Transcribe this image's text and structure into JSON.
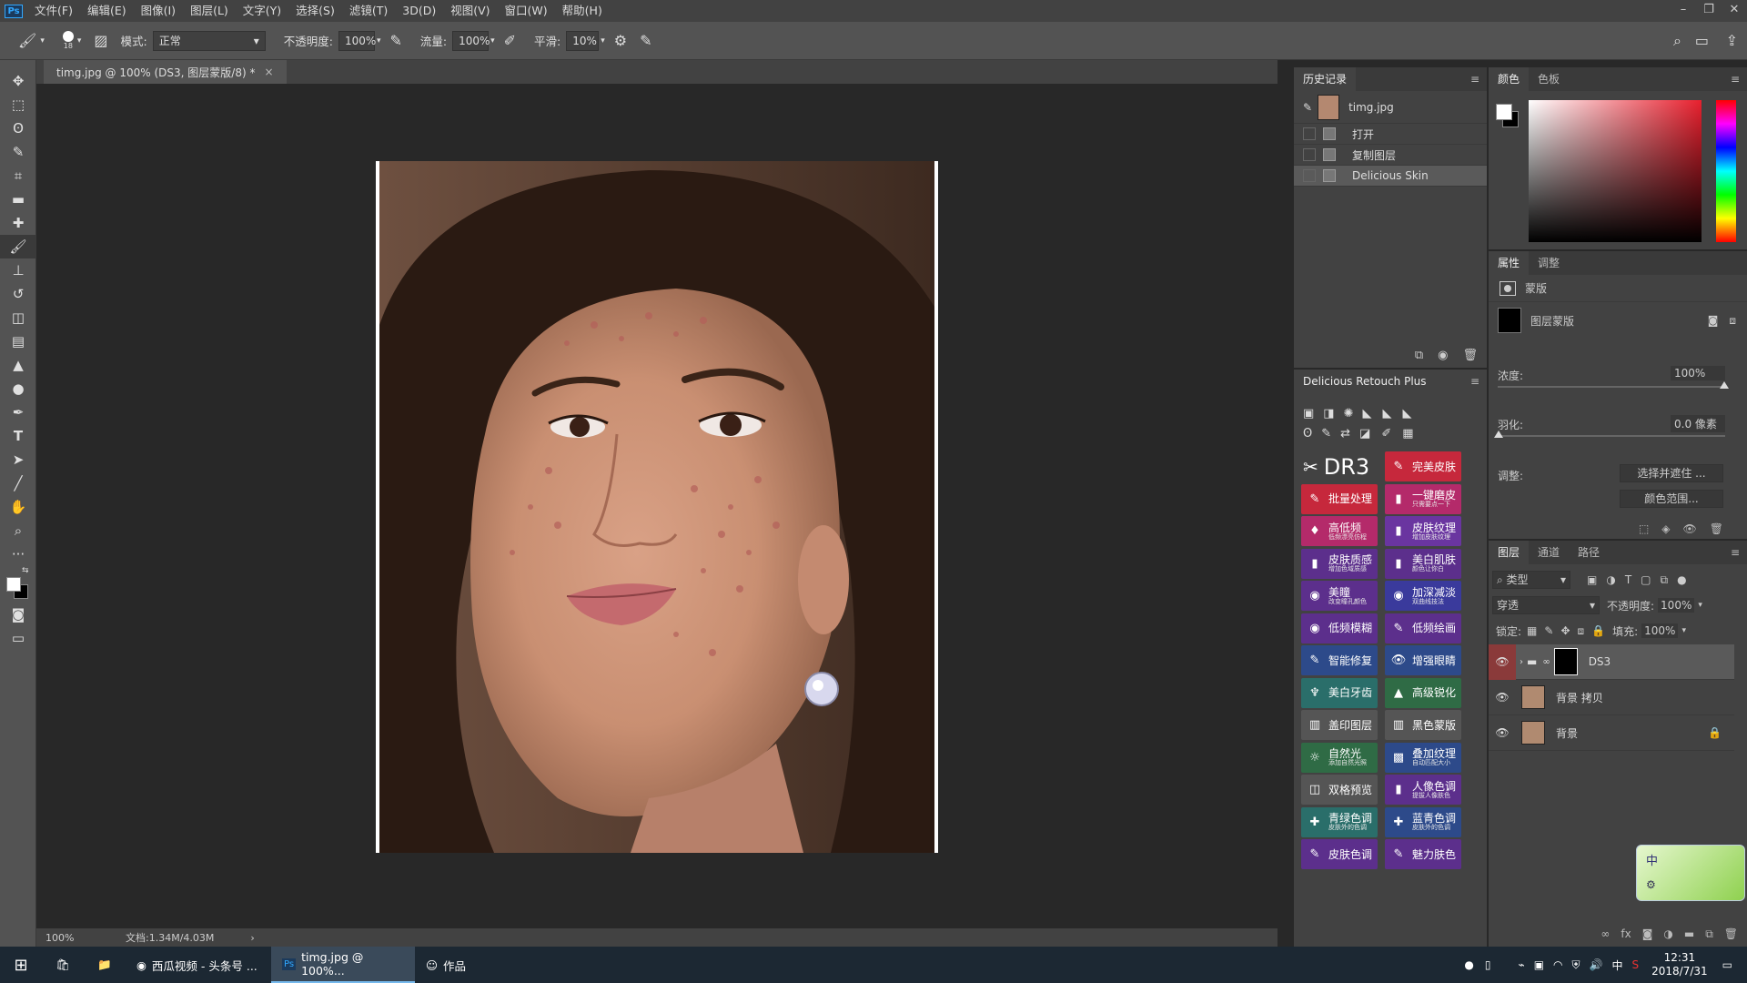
{
  "menubar": {
    "logo": "Ps",
    "items": [
      "文件(F)",
      "编辑(E)",
      "图像(I)",
      "图层(L)",
      "文字(Y)",
      "选择(S)",
      "滤镜(T)",
      "3D(D)",
      "视图(V)",
      "窗口(W)",
      "帮助(H)"
    ]
  },
  "options": {
    "brush_size": "18",
    "mode_label": "模式:",
    "mode_value": "正常",
    "opacity_label": "不透明度:",
    "opacity_value": "100%",
    "flow_label": "流量:",
    "flow_value": "100%",
    "smooth_label": "平滑:",
    "smooth_value": "10%"
  },
  "document": {
    "tab_title": "timg.jpg @ 100% (DS3, 图层蒙版/8) *",
    "tab_close": "×",
    "zoom": "100%",
    "doc_info": "文档:1.34M/4.03M"
  },
  "history": {
    "tabs": [
      "历史记录"
    ],
    "snapshot": "timg.jpg",
    "rows": [
      "打开",
      "复制图层",
      "Delicious Skin"
    ]
  },
  "dr3": {
    "title": "Delicious Retouch Plus",
    "logo": "DR3",
    "buttons": [
      {
        "label": "完美皮肤",
        "sub": "",
        "color": "red"
      },
      {
        "label": "批量处理",
        "sub": "",
        "color": "red"
      },
      {
        "label": "一键磨皮",
        "sub": "只需要点一下",
        "color": "pink"
      },
      {
        "label": "高低频",
        "sub": "低频漂亮仿程",
        "color": "pink"
      },
      {
        "label": "皮肤纹理",
        "sub": "增加皮肤纹理",
        "color": "purple"
      },
      {
        "label": "皮肤质感",
        "sub": "增加色域质感",
        "color": "violet"
      },
      {
        "label": "美白肌肤",
        "sub": "颜色让你白",
        "color": "violet"
      },
      {
        "label": "美瞳",
        "sub": "改变瞳孔颜色",
        "color": "violet"
      },
      {
        "label": "加深减淡",
        "sub": "双曲线技法",
        "color": "blue"
      },
      {
        "label": "低频模糊",
        "sub": "",
        "color": "violet"
      },
      {
        "label": "低频绘画",
        "sub": "",
        "color": "violet"
      },
      {
        "label": "智能修复",
        "sub": "",
        "color": "navy"
      },
      {
        "label": "增强眼睛",
        "sub": "",
        "color": "navy"
      },
      {
        "label": "美白牙齿",
        "sub": "",
        "color": "teal"
      },
      {
        "label": "高级锐化",
        "sub": "",
        "color": "green"
      },
      {
        "label": "盖印图层",
        "sub": "",
        "color": "gray"
      },
      {
        "label": "黑色蒙版",
        "sub": "",
        "color": "gray"
      },
      {
        "label": "自然光",
        "sub": "添加自然光照",
        "color": "green"
      },
      {
        "label": "叠加纹理",
        "sub": "自动匹配大小",
        "color": "navy"
      },
      {
        "label": "双格预览",
        "sub": "",
        "color": "gray"
      },
      {
        "label": "人像色调",
        "sub": "提拔人像肤色",
        "color": "violet"
      },
      {
        "label": "青绿色调",
        "sub": "皮肤外的色调",
        "color": "teal"
      },
      {
        "label": "蓝青色调",
        "sub": "皮肤外的色调",
        "color": "navy"
      },
      {
        "label": "皮肤色调",
        "sub": "",
        "color": "violet"
      },
      {
        "label": "魅力肤色",
        "sub": "",
        "color": "violet"
      }
    ]
  },
  "color_panel": {
    "tabs": [
      "颜色",
      "色板"
    ]
  },
  "properties": {
    "tabs": [
      "属性",
      "调整"
    ],
    "mask_title": "蒙版",
    "layer_mask": "图层蒙版",
    "density_label": "浓度:",
    "density_value": "100%",
    "feather_label": "羽化:",
    "feather_value": "0.0 像素",
    "adjust_label": "调整:",
    "select_mask_btn": "选择并遮住 ...",
    "color_range_btn": "颜色范围..."
  },
  "layers": {
    "tabs": [
      "图层",
      "通道",
      "路径"
    ],
    "filter_label": "类型",
    "blend_mode": "穿透",
    "opacity_label": "不透明度:",
    "opacity_value": "100%",
    "lock_label": "锁定:",
    "fill_label": "填充:",
    "fill_value": "100%",
    "rows": [
      "DS3",
      "背景 拷贝",
      "背景"
    ]
  },
  "ime_widget": {
    "char": "中"
  },
  "taskbar": {
    "items": [
      "西瓜视频 - 头条号 ...",
      "timg.jpg @ 100%...",
      "作品"
    ],
    "time": "12:31",
    "date": "2018/7/31",
    "ime": "中"
  }
}
